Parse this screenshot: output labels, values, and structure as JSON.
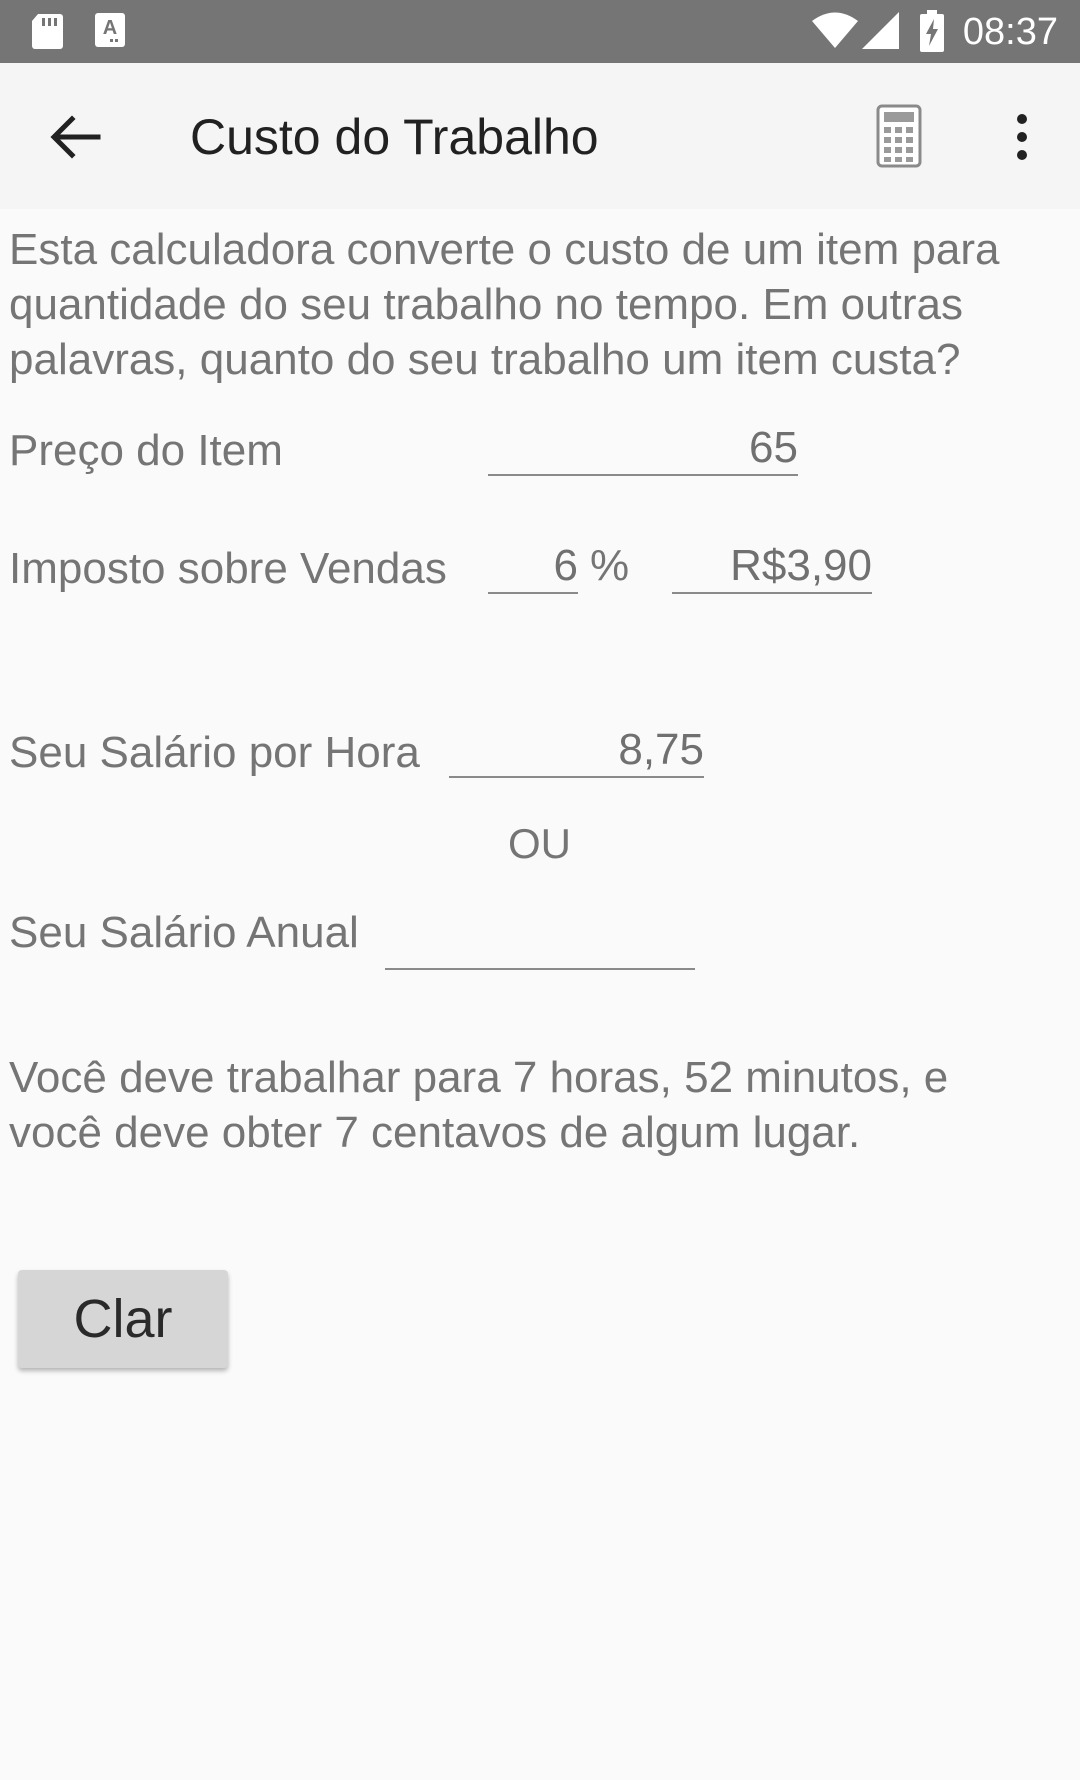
{
  "status_bar": {
    "time": "08:37",
    "icons": [
      "sd-card-icon",
      "text-a-icon",
      "wifi-icon",
      "signal-icon",
      "battery-charging-icon"
    ]
  },
  "app_bar": {
    "title": "Custo do Trabalho",
    "back_icon": "arrow-back-icon",
    "calculator_icon": "calculator-icon",
    "overflow_icon": "more-vert-icon"
  },
  "description": "Esta calculadora converte o custo de um item para\nquantidade do seu trabalho no tempo. Em outras\npalavras, quanto do seu trabalho um item custa?",
  "form": {
    "item_price": {
      "label": "Preço do Item",
      "value": "65"
    },
    "sales_tax": {
      "label": "Imposto sobre Vendas",
      "percent_value": "6",
      "percent_sign": "%",
      "tax_amount": "R$3,90"
    },
    "hourly_wage": {
      "label": "Seu Salário por Hora",
      "value": "8,75"
    },
    "or_label": "OU",
    "annual_salary": {
      "label": "Seu Salário Anual",
      "value": ""
    }
  },
  "result": "Você deve trabalhar para 7 horas, 52 minutos, e\nvocê deve obter 7 centavos de algum lugar.",
  "clear_button": "Clar",
  "colors": {
    "status_bar": "#757575",
    "app_bar": "#f5f5f5",
    "background": "#fafafa",
    "button": "#d6d6d6"
  }
}
